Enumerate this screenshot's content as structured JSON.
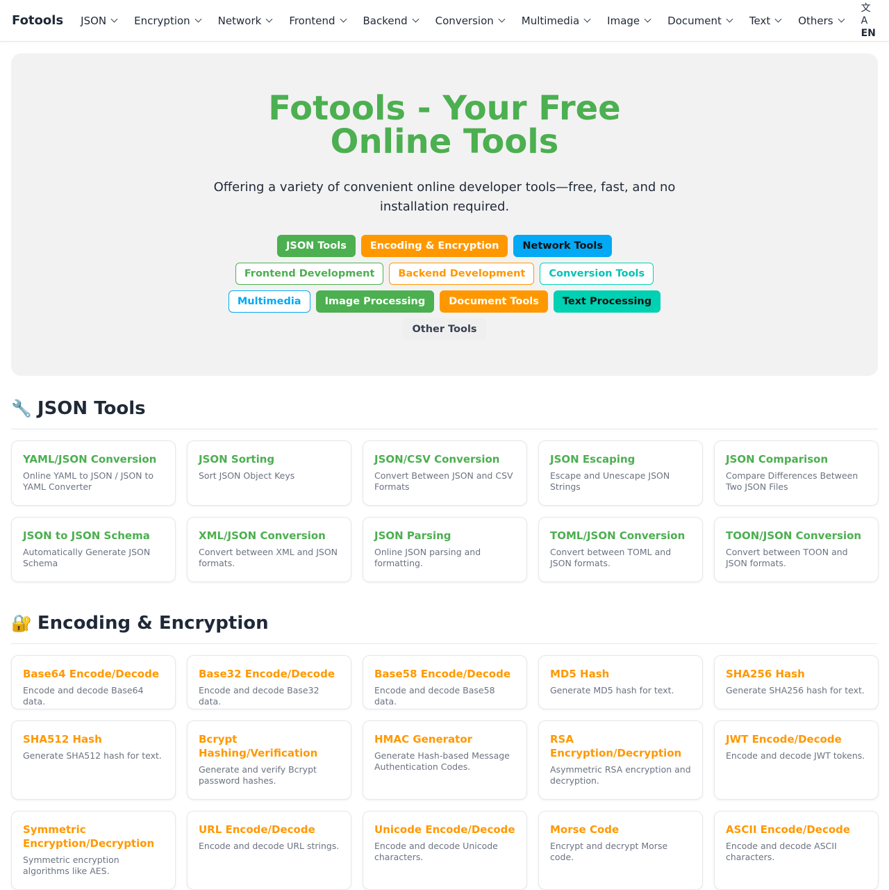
{
  "brand": "Fotools",
  "nav": [
    {
      "label": "JSON"
    },
    {
      "label": "Encryption"
    },
    {
      "label": "Network"
    },
    {
      "label": "Frontend"
    },
    {
      "label": "Backend"
    },
    {
      "label": "Conversion"
    },
    {
      "label": "Multimedia"
    },
    {
      "label": "Image"
    },
    {
      "label": "Document"
    },
    {
      "label": "Text"
    },
    {
      "label": "Others"
    }
  ],
  "lang": {
    "icon": "translate-icon",
    "glyph": "文A",
    "label": "EN"
  },
  "hero": {
    "title": "Fotools - Your Free Online Tools",
    "subtitle": "Offering a variety of convenient online developer tools—free, fast, and no installation required.",
    "chips": [
      [
        {
          "label": "JSON Tools"
        },
        {
          "label": "Encoding & Encryption"
        },
        {
          "label": "Network Tools"
        }
      ],
      [
        {
          "label": "Frontend Development"
        },
        {
          "label": "Backend Development"
        },
        {
          "label": "Conversion Tools"
        }
      ],
      [
        {
          "label": "Multimedia"
        },
        {
          "label": "Image Processing"
        },
        {
          "label": "Document Tools"
        },
        {
          "label": "Text Processing"
        }
      ],
      [
        {
          "label": "Other Tools"
        }
      ]
    ]
  },
  "sections": {
    "json": {
      "emoji": "🔧",
      "title": "JSON Tools",
      "cards": [
        {
          "title": "YAML/JSON Conversion",
          "desc": "Online YAML to JSON / JSON to YAML Converter"
        },
        {
          "title": "JSON Sorting",
          "desc": "Sort JSON Object Keys"
        },
        {
          "title": "JSON/CSV Conversion",
          "desc": "Convert Between JSON and CSV Formats"
        },
        {
          "title": "JSON Escaping",
          "desc": "Escape and Unescape JSON Strings"
        },
        {
          "title": "JSON Comparison",
          "desc": "Compare Differences Between Two JSON Files"
        },
        {
          "title": "JSON to JSON Schema",
          "desc": "Automatically Generate JSON Schema"
        },
        {
          "title": "XML/JSON Conversion",
          "desc": "Convert between XML and JSON formats."
        },
        {
          "title": "JSON Parsing",
          "desc": "Online JSON parsing and formatting."
        },
        {
          "title": "TOML/JSON Conversion",
          "desc": "Convert between TOML and JSON formats."
        },
        {
          "title": "TOON/JSON Conversion",
          "desc": "Convert between TOON and JSON formats."
        }
      ]
    },
    "encoding": {
      "emoji": "🔐",
      "title": "Encoding & Encryption",
      "cards": [
        {
          "title": "Base64 Encode/Decode",
          "desc": "Encode and decode Base64 data."
        },
        {
          "title": "Base32 Encode/Decode",
          "desc": "Encode and decode Base32 data."
        },
        {
          "title": "Base58 Encode/Decode",
          "desc": "Encode and decode Base58 data."
        },
        {
          "title": "MD5 Hash",
          "desc": "Generate MD5 hash for text."
        },
        {
          "title": "SHA256 Hash",
          "desc": "Generate SHA256 hash for text."
        },
        {
          "title": "SHA512 Hash",
          "desc": "Generate SHA512 hash for text."
        },
        {
          "title": "Bcrypt Hashing/Verification",
          "desc": "Generate and verify Bcrypt password hashes."
        },
        {
          "title": "HMAC Generator",
          "desc": "Generate Hash-based Message Authentication Codes."
        },
        {
          "title": "RSA Encryption/Decryption",
          "desc": "Asymmetric RSA encryption and decryption."
        },
        {
          "title": "JWT Encode/Decode",
          "desc": "Encode and decode JWT tokens."
        },
        {
          "title": "Symmetric Encryption/Decryption",
          "desc": "Symmetric encryption algorithms like AES."
        },
        {
          "title": "URL Encode/Decode",
          "desc": "Encode and decode URL strings."
        },
        {
          "title": "Unicode Encode/Decode",
          "desc": "Encode and decode Unicode characters."
        },
        {
          "title": "Morse Code",
          "desc": "Encrypt and decrypt Morse code."
        },
        {
          "title": "ASCII Encode/Decode",
          "desc": "Encode and decode ASCII characters."
        }
      ]
    }
  },
  "colors": {
    "green": "#4caf50",
    "orange": "#ff9800",
    "blue": "#03a9f4",
    "teal": "#00d1b2"
  }
}
